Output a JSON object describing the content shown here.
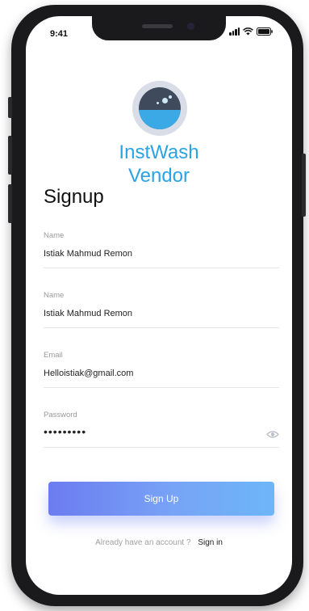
{
  "status_bar": {
    "time": "9:41",
    "icons": [
      "signal-icon",
      "wifi-icon",
      "battery-icon"
    ]
  },
  "app": {
    "brand_line1": "InstWash",
    "brand_line2": "Vendor",
    "logo_icon": "washing-machine-icon",
    "brand_color": "#2aa4e6"
  },
  "page": {
    "title": "Signup"
  },
  "form": {
    "fields": [
      {
        "label": "Name",
        "value": "Istiak Mahmud Remon"
      },
      {
        "label": "Name",
        "value": "Istiak Mahmud Remon"
      },
      {
        "label": "Email",
        "value": "Helloistiak@gmail.com"
      },
      {
        "label": "Password",
        "value": "•••••••••",
        "icon": "eye-icon"
      }
    ],
    "submit_label": "Sign Up"
  },
  "footer": {
    "prompt": "Already have an account ?",
    "link": "Sign in"
  }
}
